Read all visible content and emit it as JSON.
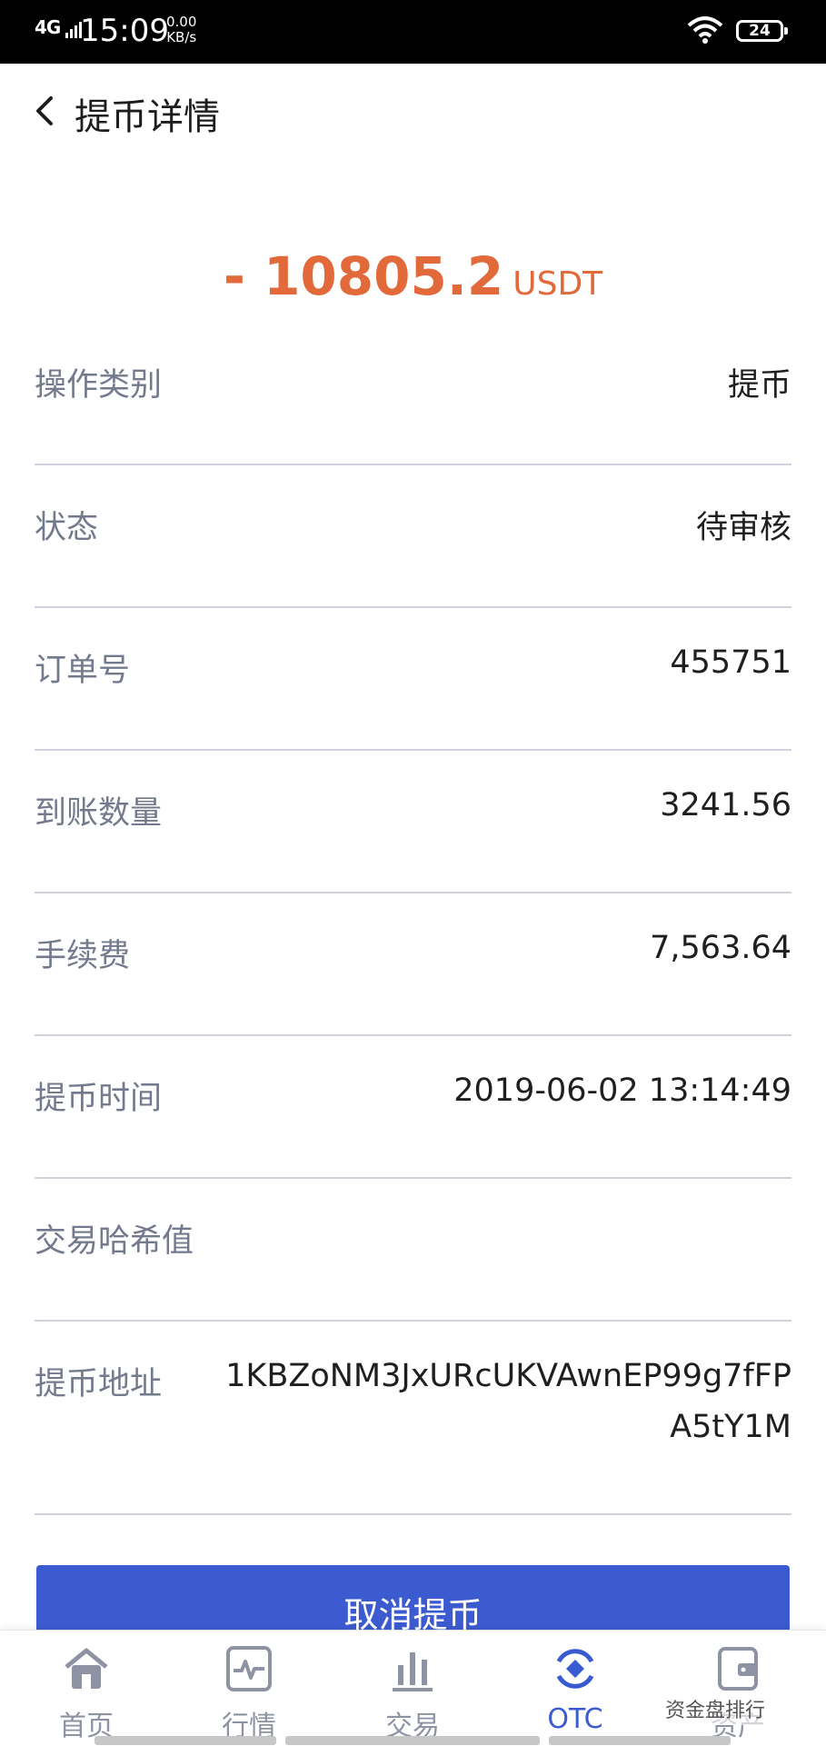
{
  "status_bar": {
    "network": "4G",
    "time": "15:09",
    "speed_value": "0.00",
    "speed_unit": "KB/s",
    "battery": "24"
  },
  "header": {
    "title": "提币详情",
    "back_icon": "chevron-left-icon"
  },
  "amount": {
    "value": "- 10805.2",
    "unit": "USDT",
    "color": "#e2693a"
  },
  "rows": [
    {
      "label": "操作类别",
      "value": "提币"
    },
    {
      "label": "状态",
      "value": "待审核"
    },
    {
      "label": "订单号",
      "value": "455751"
    },
    {
      "label": "到账数量",
      "value": "3241.56"
    },
    {
      "label": "手续费",
      "value": "7,563.64"
    },
    {
      "label": "提币时间",
      "value": "2019-06-02 13:14:49"
    },
    {
      "label": "交易哈希值",
      "value": ""
    },
    {
      "label": "提币地址",
      "value": "1KBZoNM3JxURcUKVAwnEP99g7fFPA5tY1M"
    }
  ],
  "cancel_button": {
    "label": "取消提币",
    "color": "#3c5bd0"
  },
  "tabs": [
    {
      "label": "首页",
      "icon": "home-icon",
      "active": false
    },
    {
      "label": "行情",
      "icon": "market-chart-icon",
      "active": false
    },
    {
      "label": "交易",
      "icon": "bar-chart-icon",
      "active": false
    },
    {
      "label": "OTC",
      "icon": "otc-icon",
      "active": true
    },
    {
      "label": "资产",
      "icon": "wallet-icon",
      "active": false
    }
  ],
  "watermark": "资金盘排行"
}
